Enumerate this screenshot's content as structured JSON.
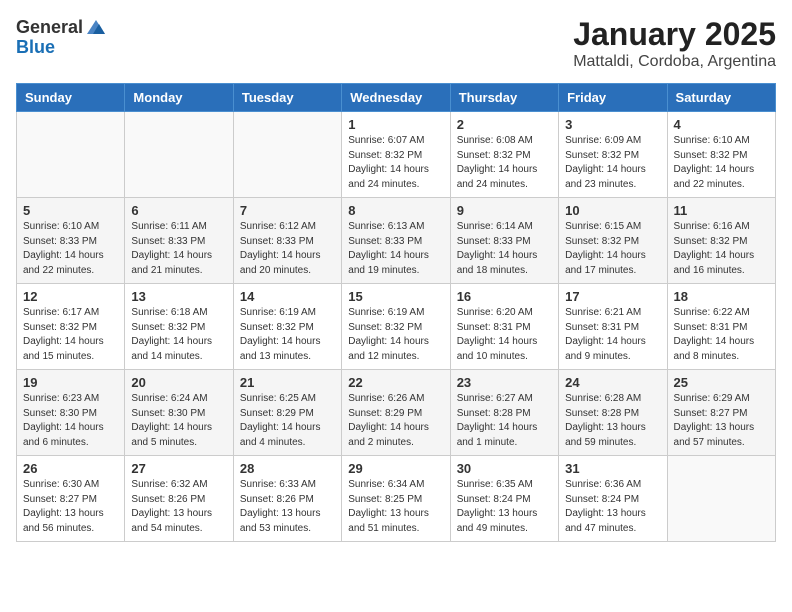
{
  "header": {
    "logo_general": "General",
    "logo_blue": "Blue",
    "month_title": "January 2025",
    "location": "Mattaldi, Cordoba, Argentina"
  },
  "days_of_week": [
    "Sunday",
    "Monday",
    "Tuesday",
    "Wednesday",
    "Thursday",
    "Friday",
    "Saturday"
  ],
  "weeks": [
    [
      {
        "day": "",
        "info": ""
      },
      {
        "day": "",
        "info": ""
      },
      {
        "day": "",
        "info": ""
      },
      {
        "day": "1",
        "info": "Sunrise: 6:07 AM\nSunset: 8:32 PM\nDaylight: 14 hours\nand 24 minutes."
      },
      {
        "day": "2",
        "info": "Sunrise: 6:08 AM\nSunset: 8:32 PM\nDaylight: 14 hours\nand 24 minutes."
      },
      {
        "day": "3",
        "info": "Sunrise: 6:09 AM\nSunset: 8:32 PM\nDaylight: 14 hours\nand 23 minutes."
      },
      {
        "day": "4",
        "info": "Sunrise: 6:10 AM\nSunset: 8:32 PM\nDaylight: 14 hours\nand 22 minutes."
      }
    ],
    [
      {
        "day": "5",
        "info": "Sunrise: 6:10 AM\nSunset: 8:33 PM\nDaylight: 14 hours\nand 22 minutes."
      },
      {
        "day": "6",
        "info": "Sunrise: 6:11 AM\nSunset: 8:33 PM\nDaylight: 14 hours\nand 21 minutes."
      },
      {
        "day": "7",
        "info": "Sunrise: 6:12 AM\nSunset: 8:33 PM\nDaylight: 14 hours\nand 20 minutes."
      },
      {
        "day": "8",
        "info": "Sunrise: 6:13 AM\nSunset: 8:33 PM\nDaylight: 14 hours\nand 19 minutes."
      },
      {
        "day": "9",
        "info": "Sunrise: 6:14 AM\nSunset: 8:33 PM\nDaylight: 14 hours\nand 18 minutes."
      },
      {
        "day": "10",
        "info": "Sunrise: 6:15 AM\nSunset: 8:32 PM\nDaylight: 14 hours\nand 17 minutes."
      },
      {
        "day": "11",
        "info": "Sunrise: 6:16 AM\nSunset: 8:32 PM\nDaylight: 14 hours\nand 16 minutes."
      }
    ],
    [
      {
        "day": "12",
        "info": "Sunrise: 6:17 AM\nSunset: 8:32 PM\nDaylight: 14 hours\nand 15 minutes."
      },
      {
        "day": "13",
        "info": "Sunrise: 6:18 AM\nSunset: 8:32 PM\nDaylight: 14 hours\nand 14 minutes."
      },
      {
        "day": "14",
        "info": "Sunrise: 6:19 AM\nSunset: 8:32 PM\nDaylight: 14 hours\nand 13 minutes."
      },
      {
        "day": "15",
        "info": "Sunrise: 6:19 AM\nSunset: 8:32 PM\nDaylight: 14 hours\nand 12 minutes."
      },
      {
        "day": "16",
        "info": "Sunrise: 6:20 AM\nSunset: 8:31 PM\nDaylight: 14 hours\nand 10 minutes."
      },
      {
        "day": "17",
        "info": "Sunrise: 6:21 AM\nSunset: 8:31 PM\nDaylight: 14 hours\nand 9 minutes."
      },
      {
        "day": "18",
        "info": "Sunrise: 6:22 AM\nSunset: 8:31 PM\nDaylight: 14 hours\nand 8 minutes."
      }
    ],
    [
      {
        "day": "19",
        "info": "Sunrise: 6:23 AM\nSunset: 8:30 PM\nDaylight: 14 hours\nand 6 minutes."
      },
      {
        "day": "20",
        "info": "Sunrise: 6:24 AM\nSunset: 8:30 PM\nDaylight: 14 hours\nand 5 minutes."
      },
      {
        "day": "21",
        "info": "Sunrise: 6:25 AM\nSunset: 8:29 PM\nDaylight: 14 hours\nand 4 minutes."
      },
      {
        "day": "22",
        "info": "Sunrise: 6:26 AM\nSunset: 8:29 PM\nDaylight: 14 hours\nand 2 minutes."
      },
      {
        "day": "23",
        "info": "Sunrise: 6:27 AM\nSunset: 8:28 PM\nDaylight: 14 hours\nand 1 minute."
      },
      {
        "day": "24",
        "info": "Sunrise: 6:28 AM\nSunset: 8:28 PM\nDaylight: 13 hours\nand 59 minutes."
      },
      {
        "day": "25",
        "info": "Sunrise: 6:29 AM\nSunset: 8:27 PM\nDaylight: 13 hours\nand 57 minutes."
      }
    ],
    [
      {
        "day": "26",
        "info": "Sunrise: 6:30 AM\nSunset: 8:27 PM\nDaylight: 13 hours\nand 56 minutes."
      },
      {
        "day": "27",
        "info": "Sunrise: 6:32 AM\nSunset: 8:26 PM\nDaylight: 13 hours\nand 54 minutes."
      },
      {
        "day": "28",
        "info": "Sunrise: 6:33 AM\nSunset: 8:26 PM\nDaylight: 13 hours\nand 53 minutes."
      },
      {
        "day": "29",
        "info": "Sunrise: 6:34 AM\nSunset: 8:25 PM\nDaylight: 13 hours\nand 51 minutes."
      },
      {
        "day": "30",
        "info": "Sunrise: 6:35 AM\nSunset: 8:24 PM\nDaylight: 13 hours\nand 49 minutes."
      },
      {
        "day": "31",
        "info": "Sunrise: 6:36 AM\nSunset: 8:24 PM\nDaylight: 13 hours\nand 47 minutes."
      },
      {
        "day": "",
        "info": ""
      }
    ]
  ]
}
